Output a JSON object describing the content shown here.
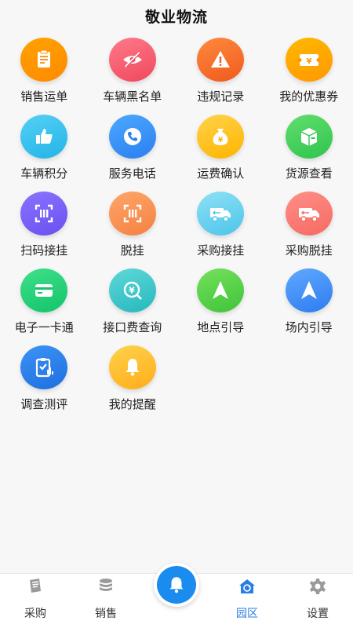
{
  "header": {
    "title": "敬业物流"
  },
  "tiles": [
    {
      "label": "销售运单",
      "icon": "clipboard-icon",
      "colors": [
        "#ffa200",
        "#ff8a00"
      ]
    },
    {
      "label": "车辆黑名单",
      "icon": "eye-off-icon",
      "colors": [
        "#ff7a8a",
        "#f0485c"
      ]
    },
    {
      "label": "违规记录",
      "icon": "warning-icon",
      "colors": [
        "#ff8a3d",
        "#f05a1e"
      ]
    },
    {
      "label": "我的优惠券",
      "icon": "coupon-icon",
      "colors": [
        "#ffb800",
        "#ff9800"
      ]
    },
    {
      "label": "车辆积分",
      "icon": "thumbs-up-icon",
      "colors": [
        "#55d0f5",
        "#23b4e8"
      ]
    },
    {
      "label": "服务电话",
      "icon": "phone-icon",
      "colors": [
        "#4ca8ff",
        "#2b7ff0"
      ]
    },
    {
      "label": "运费确认",
      "icon": "money-bag-icon",
      "colors": [
        "#ffd34a",
        "#ffb400"
      ]
    },
    {
      "label": "货源查看",
      "icon": "package-icon",
      "colors": [
        "#62de6c",
        "#2fc450"
      ]
    },
    {
      "label": "扫码接挂",
      "icon": "scan-icon",
      "colors": [
        "#8a74ff",
        "#6a4ff0"
      ]
    },
    {
      "label": "脱挂",
      "icon": "scan-icon",
      "colors": [
        "#ffa56a",
        "#f48240"
      ]
    },
    {
      "label": "采购接挂",
      "icon": "truck-icon",
      "colors": [
        "#8fe0f5",
        "#4cc5ea"
      ]
    },
    {
      "label": "采购脱挂",
      "icon": "truck-icon",
      "colors": [
        "#ff8f86",
        "#f56a64"
      ]
    },
    {
      "label": "电子一卡通",
      "icon": "card-icon",
      "colors": [
        "#3fe08a",
        "#12c46a"
      ]
    },
    {
      "label": "接口费查询",
      "icon": "yuan-search-icon",
      "colors": [
        "#5fd8d8",
        "#26b8bd"
      ]
    },
    {
      "label": "地点引导",
      "icon": "navigation-icon",
      "colors": [
        "#76e05c",
        "#3fc43a"
      ]
    },
    {
      "label": "场内引导",
      "icon": "navigation-icon",
      "colors": [
        "#60a8ff",
        "#2d7cf0"
      ]
    },
    {
      "label": "调查测评",
      "icon": "survey-icon",
      "colors": [
        "#3b93f5",
        "#1f6fe0"
      ]
    },
    {
      "label": "我的提醒",
      "icon": "bell-icon",
      "colors": [
        "#ffd24a",
        "#ffad1a"
      ]
    }
  ],
  "tabbar": {
    "tabs": [
      {
        "label": "采购",
        "icon": "document-icon"
      },
      {
        "label": "销售",
        "icon": "database-icon"
      },
      {
        "label": "园区",
        "icon": "park-home-icon"
      },
      {
        "label": "设置",
        "icon": "gear-icon"
      }
    ],
    "active": "园区",
    "center_icon": "bell-icon",
    "accent": "#1a8cf0"
  }
}
